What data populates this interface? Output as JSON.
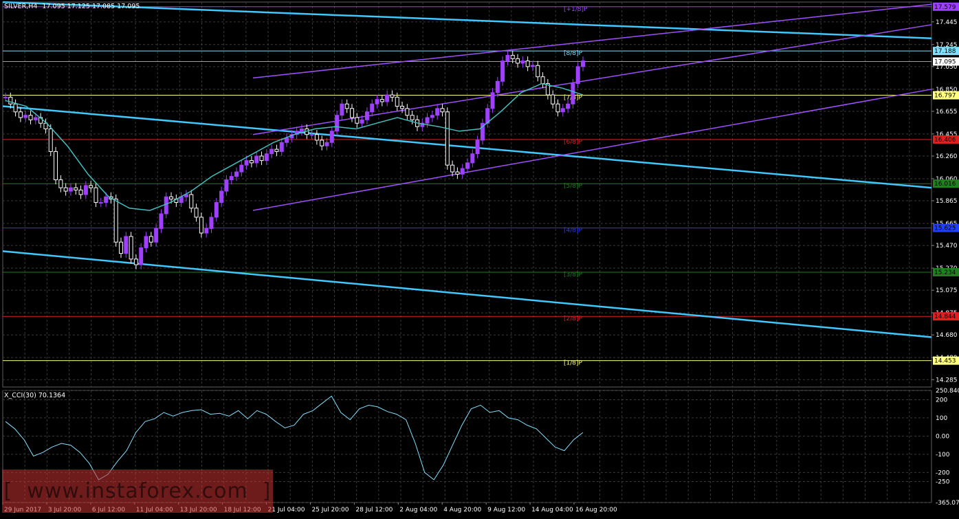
{
  "chart_data": [
    {
      "type": "candlestick",
      "title": "SILVER,H4",
      "ohlc_header": "17.095 17.125 17.085 17.095",
      "ylim": [
        14.22,
        17.62
      ],
      "y_ticks": [
        "17.445",
        "17.245",
        "17.050",
        "16.850",
        "16.655",
        "16.455",
        "16.260",
        "16.060",
        "15.865",
        "15.665",
        "15.470",
        "15.270",
        "15.075",
        "14.875",
        "14.680",
        "14.480",
        "14.285"
      ],
      "x_labels": [
        "29 Jun 2017",
        "3 Jul 20:00",
        "6 Jul 12:00",
        "11 Jul 04:00",
        "13 Jul 20:00",
        "18 Jul 12:00",
        "21 Jul 04:00",
        "25 Jul 20:00",
        "28 Jul 12:00",
        "2 Aug 04:00",
        "4 Aug 20:00",
        "9 Aug 12:00",
        "14 Aug 04:00",
        "16 Aug 20:00"
      ],
      "last_price": "17.095",
      "murrey_levels": [
        {
          "label": "[+1/8]P",
          "value": 17.579,
          "price_label": "17.579",
          "color": "#a040ff"
        },
        {
          "label": "[8/8]P",
          "value": 17.188,
          "price_label": "17.188",
          "color": "#7fe0ff"
        },
        {
          "label": "[7/8]P",
          "value": 16.797,
          "price_label": "16.797",
          "color": "#ffff80"
        },
        {
          "label": "[6/8]P",
          "value": 16.406,
          "price_label": "16.406",
          "color": "#e02020"
        },
        {
          "label": "[5/8]P",
          "value": 16.016,
          "price_label": "16.016",
          "color": "#208020"
        },
        {
          "label": "[4/8]P",
          "value": 15.625,
          "price_label": "15.625",
          "color": "#2040ff"
        },
        {
          "label": "[3/8]P",
          "value": 15.234,
          "price_label": "15.234",
          "color": "#208020"
        },
        {
          "label": "[2/8]P",
          "value": 14.844,
          "price_label": "14.844",
          "color": "#e02020"
        },
        {
          "label": "[1/8]P",
          "value": 14.453,
          "price_label": "14.453",
          "color": "#ffff80"
        }
      ],
      "closes": [
        16.78,
        16.72,
        16.65,
        16.6,
        16.62,
        16.58,
        16.6,
        16.55,
        16.5,
        16.3,
        16.05,
        15.98,
        15.95,
        15.98,
        15.96,
        15.92,
        16.0,
        15.98,
        15.85,
        15.85,
        15.9,
        15.88,
        15.5,
        15.4,
        15.55,
        15.35,
        15.3,
        15.45,
        15.55,
        15.5,
        15.62,
        15.75,
        15.9,
        15.88,
        15.85,
        15.9,
        15.92,
        15.8,
        15.72,
        15.58,
        15.62,
        15.72,
        15.85,
        15.95,
        16.05,
        16.08,
        16.12,
        16.18,
        16.22,
        16.2,
        16.26,
        16.22,
        16.28,
        16.32,
        16.3,
        16.38,
        16.42,
        16.45,
        16.48,
        16.5,
        16.45,
        16.45,
        16.4,
        16.35,
        16.38,
        16.48,
        16.62,
        16.72,
        16.68,
        16.6,
        16.55,
        16.58,
        16.65,
        16.72,
        16.76,
        16.74,
        16.8,
        16.78,
        16.7,
        16.68,
        16.62,
        16.58,
        16.52,
        16.55,
        16.6,
        16.62,
        16.68,
        16.65,
        16.18,
        16.12,
        16.1,
        16.15,
        16.2,
        16.28,
        16.4,
        16.55,
        16.68,
        16.82,
        16.92,
        17.1,
        17.15,
        17.12,
        17.08,
        17.1,
        17.05,
        17.06,
        16.96,
        16.9,
        16.8,
        16.72,
        16.65,
        16.68,
        16.72,
        16.9,
        17.05,
        17.1
      ],
      "ma_values": [
        16.75,
        16.7,
        16.55,
        16.35,
        16.1,
        15.9,
        15.8,
        15.78,
        15.85,
        15.95,
        16.08,
        16.18,
        16.28,
        16.38,
        16.45,
        16.5,
        16.52,
        16.5,
        16.55,
        16.6,
        16.55,
        16.52,
        16.48,
        16.5,
        16.65,
        16.82,
        16.9,
        16.86,
        16.8
      ],
      "trend_lines": [
        {
          "name": "upper-channel-line",
          "value_left": 17.62,
          "value_right": 17.3
        },
        {
          "name": "middle-channel-line",
          "value_left": 16.7,
          "value_right": 15.98
        },
        {
          "name": "lower-channel-line",
          "value_left": 15.42,
          "value_right": 14.66
        }
      ],
      "up_channel_lines": [
        {
          "name": "up-channel-top",
          "value_left": 16.95,
          "value_right": 17.6
        },
        {
          "name": "up-channel-mid",
          "value_left": 16.45,
          "value_right": 17.42
        },
        {
          "name": "up-channel-bottom",
          "value_left": 15.78,
          "value_right": 16.85
        }
      ],
      "colors": {
        "bull": "#a040ff",
        "bear": "#ffffff",
        "ma": "#40c0c0",
        "channel": "#40c8ff",
        "upchannel": "#a050ff",
        "grid": "#3a3a3a",
        "axis_text": "#ffffff"
      }
    },
    {
      "type": "line",
      "title": "X_CCI(30) 70.1364",
      "ylim": [
        -365.0784,
        250.8402
      ],
      "y_ticks": [
        "250.8402",
        "200",
        "100",
        "0.00",
        "-100",
        "-200",
        "-250",
        "-365.0784"
      ],
      "values": [
        80,
        40,
        -20,
        -110,
        -90,
        -60,
        -40,
        -50,
        -90,
        -150,
        -240,
        -210,
        -140,
        -80,
        20,
        80,
        95,
        130,
        110,
        130,
        140,
        145,
        120,
        125,
        110,
        140,
        95,
        140,
        120,
        80,
        45,
        60,
        120,
        140,
        180,
        220,
        130,
        90,
        150,
        170,
        160,
        135,
        120,
        90,
        -40,
        -200,
        -240,
        -160,
        -50,
        60,
        150,
        170,
        130,
        140,
        100,
        90,
        60,
        40,
        -10,
        -60,
        -80,
        -20,
        20
      ],
      "line_color": "#7fe0ff"
    }
  ],
  "watermark": {
    "text": "[  www.instaforex.com  ]",
    "color": "#c83232"
  }
}
